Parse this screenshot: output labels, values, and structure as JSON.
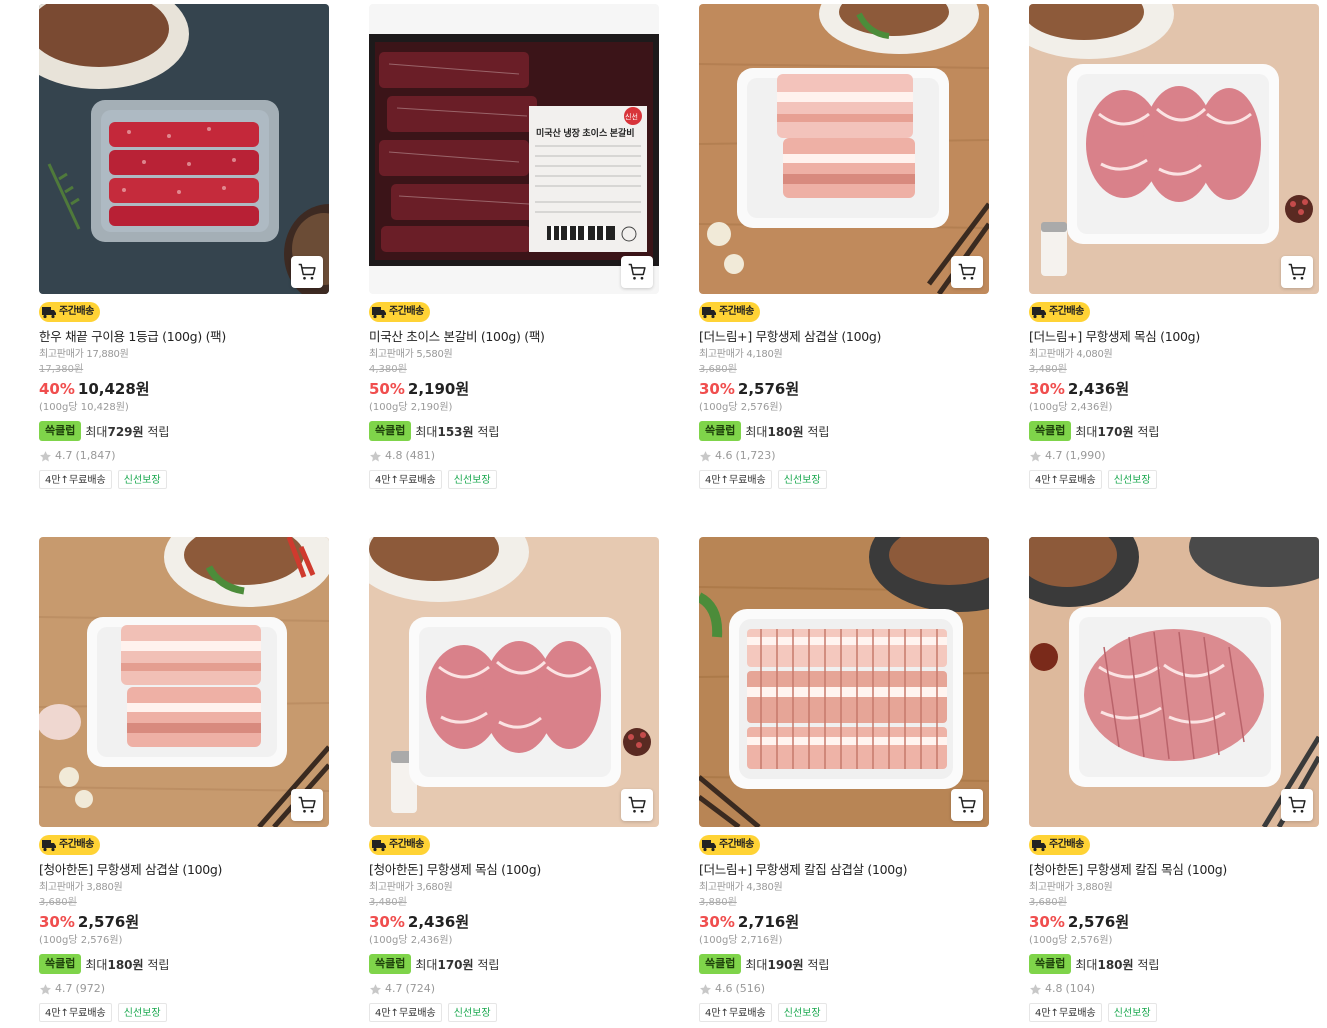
{
  "colors": {
    "discount": "#f04e4e",
    "delivery_badge": "#ffd335",
    "points_badge": "#7fd44a",
    "fresh_tag": "#1aa84f"
  },
  "products": [
    {
      "title": "한우 채끝 구이용 1등급 (100g) (팩)",
      "delivery": "주간배송",
      "max_price": "최고판매가 17,880원",
      "original_price": "17,380원",
      "discount": "40%",
      "sale_price": "10,428원",
      "unit_price": "(100g당 10,428원)",
      "points_badge": "쓱클럽",
      "points_prefix": "최대",
      "points_amount": "729원",
      "points_suffix": "적립",
      "rating": "4.7",
      "reviews": "(1,847)",
      "tags": [
        "4만↑무료배송",
        "신선보장"
      ],
      "image": "beef-tray"
    },
    {
      "title": "미국산 초이스 본갈비 (100g) (팩)",
      "delivery": "주간배송",
      "max_price": "최고판매가 5,580원",
      "original_price": "4,380원",
      "discount": "50%",
      "sale_price": "2,190원",
      "unit_price": "(100g당 2,190원)",
      "points_badge": "쓱클럽",
      "points_prefix": "최대",
      "points_amount": "153원",
      "points_suffix": "적립",
      "rating": "4.8",
      "reviews": "(481)",
      "tags": [
        "4만↑무료배송",
        "신선보장"
      ],
      "image": "vacuum-ribs",
      "label": {
        "title": "미국산 냉장 초이스 본갈비",
        "stamp": "신선"
      }
    },
    {
      "title": "[더느림+] 무항생제 삼겹살 (100g)",
      "delivery": "주간배송",
      "max_price": "최고판매가 4,180원",
      "original_price": "3,680원",
      "discount": "30%",
      "sale_price": "2,576원",
      "unit_price": "(100g당 2,576원)",
      "points_badge": "쓱클럽",
      "points_prefix": "최대",
      "points_amount": "180원",
      "points_suffix": "적립",
      "rating": "4.6",
      "reviews": "(1,723)",
      "tags": [
        "4만↑무료배송",
        "신선보장"
      ],
      "image": "pork-belly"
    },
    {
      "title": "[더느림+] 무항생제 목심 (100g)",
      "delivery": "주간배송",
      "max_price": "최고판매가 4,080원",
      "original_price": "3,480원",
      "discount": "30%",
      "sale_price": "2,436원",
      "unit_price": "(100g당 2,436원)",
      "points_badge": "쓱클럽",
      "points_prefix": "최대",
      "points_amount": "170원",
      "points_suffix": "적립",
      "rating": "4.7",
      "reviews": "(1,990)",
      "tags": [
        "4만↑무료배송",
        "신선보장"
      ],
      "image": "pork-neck"
    },
    {
      "title": "[청아한돈] 무항생제 삼겹살 (100g)",
      "delivery": "주간배송",
      "max_price": "최고판매가 3,880원",
      "original_price": "3,680원",
      "discount": "30%",
      "sale_price": "2,576원",
      "unit_price": "(100g당 2,576원)",
      "points_badge": "쓱클럽",
      "points_prefix": "최대",
      "points_amount": "180원",
      "points_suffix": "적립",
      "rating": "4.7",
      "reviews": "(972)",
      "tags": [
        "4만↑무료배송",
        "신선보장"
      ],
      "image": "pork-belly"
    },
    {
      "title": "[청아한돈] 무항생제 목심 (100g)",
      "delivery": "주간배송",
      "max_price": "최고판매가 3,680원",
      "original_price": "3,480원",
      "discount": "30%",
      "sale_price": "2,436원",
      "unit_price": "(100g당 2,436원)",
      "points_badge": "쓱클럽",
      "points_prefix": "최대",
      "points_amount": "170원",
      "points_suffix": "적립",
      "rating": "4.7",
      "reviews": "(724)",
      "tags": [
        "4만↑무료배송",
        "신선보장"
      ],
      "image": "pork-neck"
    },
    {
      "title": "[더느림+] 무항생제 칼집 삼겹살 (100g)",
      "delivery": "주간배송",
      "max_price": "최고판매가 4,380원",
      "original_price": "3,880원",
      "discount": "30%",
      "sale_price": "2,716원",
      "unit_price": "(100g당 2,716원)",
      "points_badge": "쓱클럽",
      "points_prefix": "최대",
      "points_amount": "190원",
      "points_suffix": "적립",
      "rating": "4.6",
      "reviews": "(516)",
      "tags": [
        "4만↑무료배송",
        "신선보장"
      ],
      "image": "scored-belly"
    },
    {
      "title": "[청아한돈] 무항생제 칼집 목심 (100g)",
      "delivery": "주간배송",
      "max_price": "최고판매가 3,880원",
      "original_price": "3,680원",
      "discount": "30%",
      "sale_price": "2,576원",
      "unit_price": "(100g당 2,576원)",
      "points_badge": "쓱클럽",
      "points_prefix": "최대",
      "points_amount": "180원",
      "points_suffix": "적립",
      "rating": "4.8",
      "reviews": "(104)",
      "tags": [
        "4만↑무료배송",
        "신선보장"
      ],
      "image": "scored-neck"
    }
  ]
}
